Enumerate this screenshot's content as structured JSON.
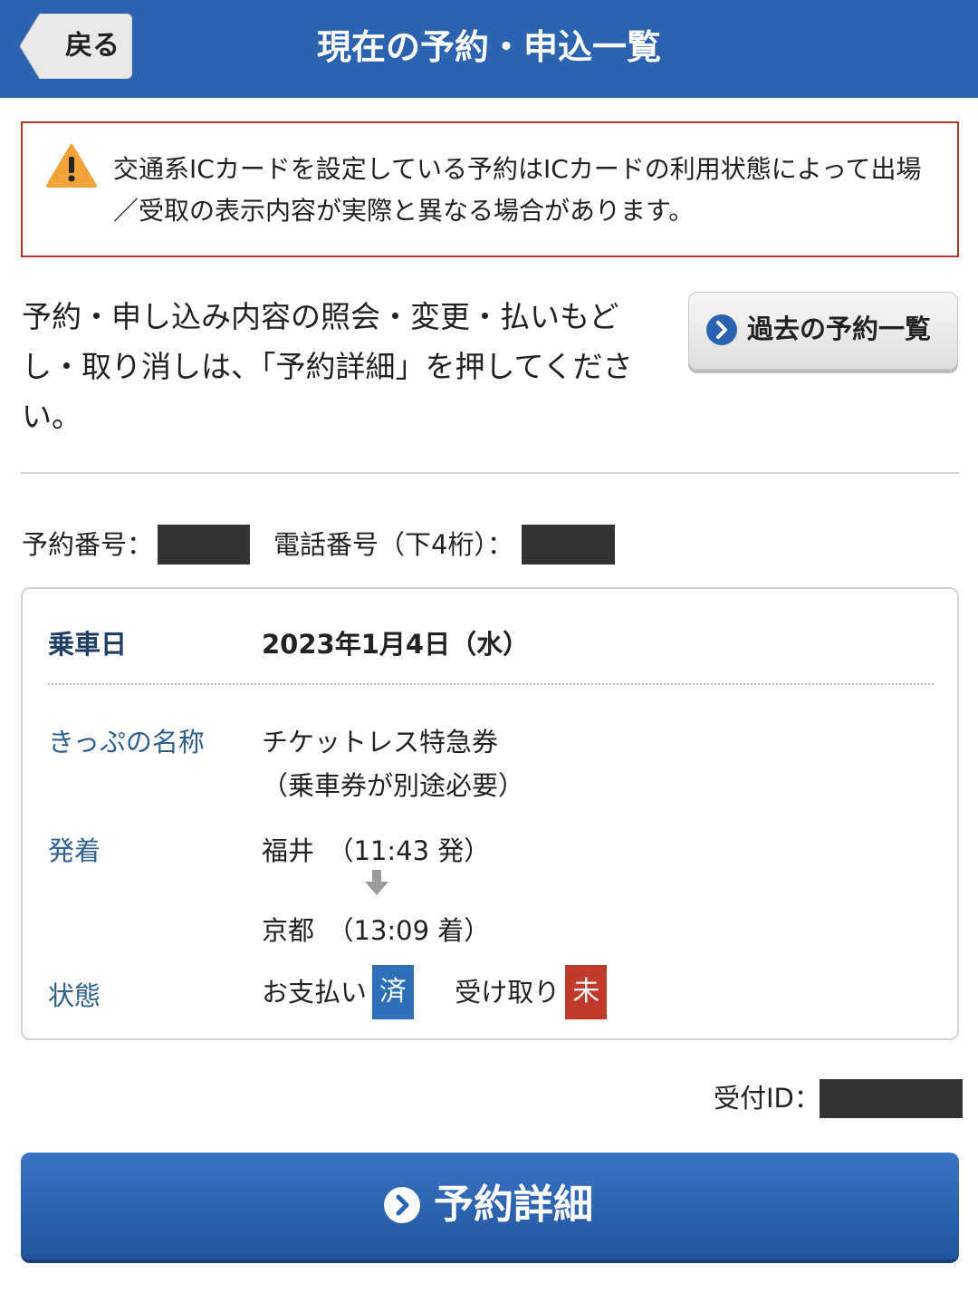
{
  "header": {
    "back_label": "戻る",
    "title": "現在の予約・申込一覧"
  },
  "notice": {
    "text": "交通系ICカードを設定している予約はICカードの利用状態によって出場／受取の表示内容が実際と異なる場合があります。"
  },
  "instruction": "予約・申し込み内容の照会・変更・払いもどし・取り消しは、「予約詳細」を押してください。",
  "past_button_label": "過去の予約一覧",
  "reservation_number_label": "予約番号：",
  "phone_label": "電話番号（下4桁）：",
  "card": {
    "ride_date_label": "乗車日",
    "ride_date": "2023年1月4日（水）",
    "ticket_name_label": "きっぷの名称",
    "ticket_name_line1": "チケットレス特急券",
    "ticket_name_line2": "（乗車券が別途必要）",
    "route_label": "発着",
    "departure": "福井　（11:43 発）",
    "arrival": "京都　（13:09 着）",
    "status_label": "状態",
    "payment_label": "お支払い",
    "payment_badge": "済",
    "pickup_label": "受け取り",
    "pickup_badge": "未"
  },
  "receipt_id_label": "受付ID：",
  "detail_button_label": "予約詳細",
  "colors": {
    "header_bg": "#2c63b0",
    "label_blue": "#2f5f8f",
    "paid_badge": "#2c6fb8",
    "pending_badge": "#c0392b",
    "notice_border": "#b03a2e",
    "warning_icon": "#f2a33a"
  }
}
